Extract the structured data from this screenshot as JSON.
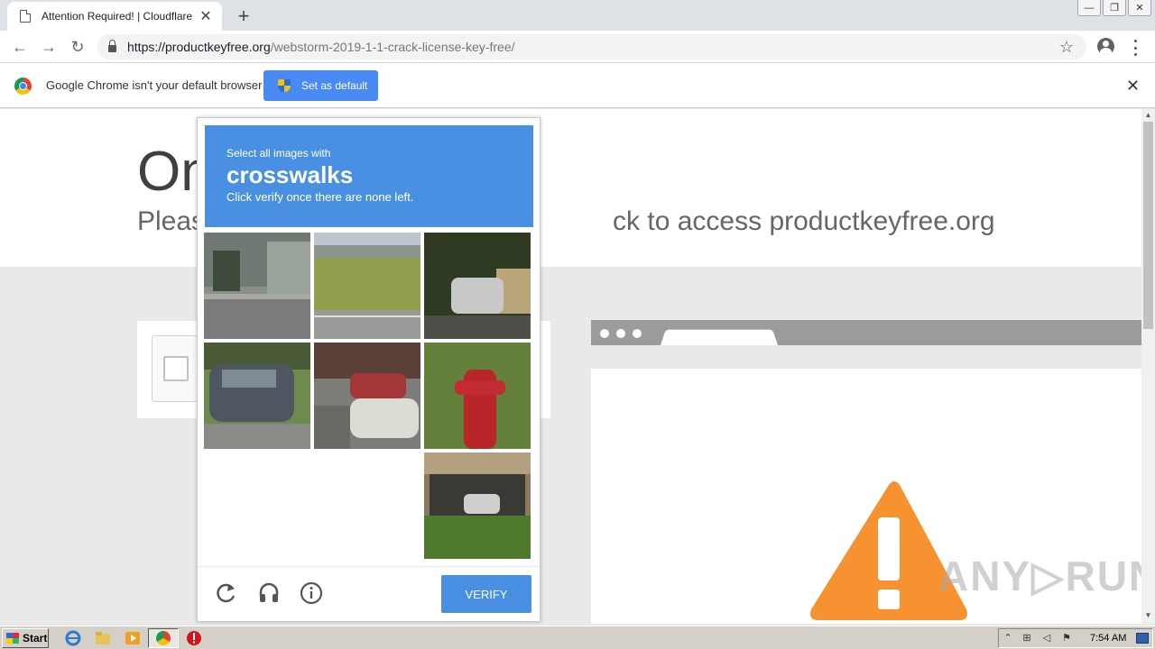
{
  "browser": {
    "tab_title": "Attention Required! | Cloudflare",
    "tab_close": "✕",
    "new_tab": "+",
    "url_host": "https://productkeyfree.org",
    "url_path": "/webstorm-2019-1-1-crack-license-key-free/",
    "back": "←",
    "forward": "→",
    "reload": "↻",
    "star": "☆",
    "window_controls": [
      "—",
      "❐",
      "✕"
    ]
  },
  "infobar": {
    "message": "Google Chrome isn't your default browser",
    "button": "Set as default",
    "close": "✕"
  },
  "page": {
    "heading": "On",
    "subheading_left": "Pleas",
    "subheading_right": "ck to access productkeyfree.org",
    "watermark": "ANY▷RUN"
  },
  "captcha": {
    "instruction": "Select all images with",
    "target": "crosswalks",
    "hint": "Click verify once there are none left.",
    "verify_label": "VERIFY",
    "tiles": [
      {
        "name": "tile-building-street",
        "empty": false
      },
      {
        "name": "tile-field-road",
        "empty": false
      },
      {
        "name": "tile-car-tree",
        "empty": false
      },
      {
        "name": "tile-parked-car",
        "empty": false
      },
      {
        "name": "tile-parking-lot",
        "empty": false
      },
      {
        "name": "tile-fire-hydrant",
        "empty": false
      },
      {
        "name": "tile-empty-1",
        "empty": true
      },
      {
        "name": "tile-empty-2",
        "empty": true
      },
      {
        "name": "tile-storefront",
        "empty": false
      }
    ],
    "accent": "#4a90e2"
  },
  "taskbar": {
    "start_label": "Start",
    "clock": "7:54 AM"
  },
  "colors": {
    "warning": "#f6922f",
    "chrome_button": "#4a8af4"
  }
}
